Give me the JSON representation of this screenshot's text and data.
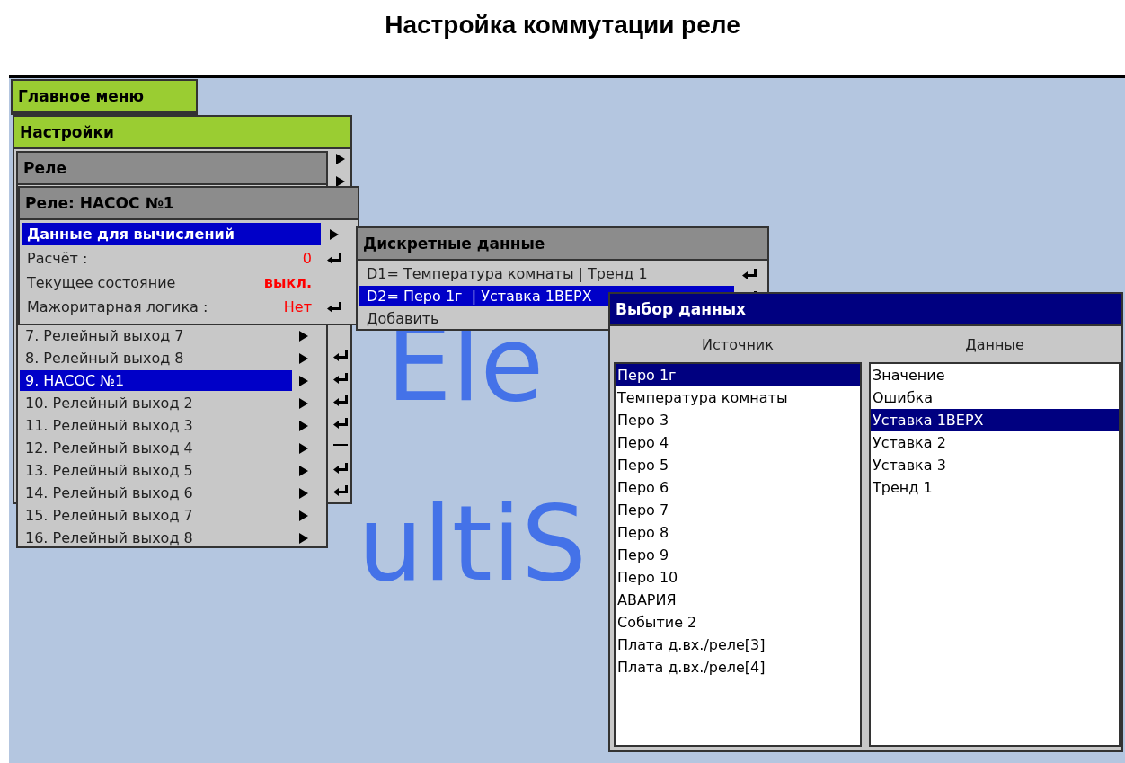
{
  "page_title": "Настройка коммутации реле",
  "background_logo": [
    "Ele",
    "ultiS"
  ],
  "main_menu": {
    "title": "Главное меню"
  },
  "settings_menu": {
    "title": "Настройки"
  },
  "relay_list": {
    "title": "Реле",
    "items": [
      {
        "label": "7. Релейный выход 7",
        "selected": false
      },
      {
        "label": "8. Релейный выход 8",
        "selected": false
      },
      {
        "label": "9. НАСОС №1",
        "selected": true
      },
      {
        "label": "10. Релейный выход 2",
        "selected": false
      },
      {
        "label": "11. Релейный выход 3",
        "selected": false
      },
      {
        "label": "12. Релейный выход 4",
        "selected": false
      },
      {
        "label": "13. Релейный выход 5",
        "selected": false
      },
      {
        "label": "14. Релейный выход 6",
        "selected": false
      },
      {
        "label": "15. Релейный выход 7",
        "selected": false
      },
      {
        "label": "16. Релейный выход 8",
        "selected": false
      }
    ]
  },
  "relay_window": {
    "title": "Реле: НАСОС №1",
    "rows": [
      {
        "kind": "submenu",
        "label": "Данные для вычислений",
        "selected": true
      },
      {
        "kind": "value",
        "label": "Расчёт :",
        "value": "0",
        "selected": false
      },
      {
        "kind": "status",
        "label": "Текущее состояние",
        "value": "выкл.",
        "selected": false
      },
      {
        "kind": "value",
        "label": "Мажоритарная логика :",
        "value": "Нет",
        "selected": false
      }
    ]
  },
  "discrete_window": {
    "title": "Дискретные данные",
    "rows": [
      {
        "kind": "entry",
        "label": "D1= Температура комнаты | Тренд 1",
        "selected": false
      },
      {
        "kind": "entry",
        "label": "D2= Перо 1г  | Уставка 1ВЕРХ",
        "selected": true
      },
      {
        "kind": "action",
        "label": "Добавить",
        "selected": false
      }
    ]
  },
  "data_dialog": {
    "title": "Выбор данных",
    "source": {
      "heading": "Источник",
      "items": [
        {
          "label": "Перо 1г",
          "selected": true
        },
        {
          "label": "Температура комнаты",
          "selected": false
        },
        {
          "label": "Перо 3",
          "selected": false
        },
        {
          "label": "Перо 4",
          "selected": false
        },
        {
          "label": "Перо 5",
          "selected": false
        },
        {
          "label": "Перо 6",
          "selected": false
        },
        {
          "label": "Перо 7",
          "selected": false
        },
        {
          "label": "Перо 8",
          "selected": false
        },
        {
          "label": "Перо 9",
          "selected": false
        },
        {
          "label": "Перо 10",
          "selected": false
        },
        {
          "label": "АВАРИЯ",
          "selected": false
        },
        {
          "label": "Событие 2",
          "selected": false
        },
        {
          "label": "Плата д.вх./реле[3]",
          "selected": false
        },
        {
          "label": "Плата д.вх./реле[4]",
          "selected": false
        }
      ]
    },
    "data": {
      "heading": "Данные",
      "items": [
        {
          "label": "Значение",
          "selected": false
        },
        {
          "label": "Ошибка",
          "selected": false
        },
        {
          "label": "Уставка 1ВЕРХ",
          "selected": true
        },
        {
          "label": "Уставка 2",
          "selected": false
        },
        {
          "label": "Уставка 3",
          "selected": false
        },
        {
          "label": "Тренд 1",
          "selected": false
        }
      ]
    }
  }
}
